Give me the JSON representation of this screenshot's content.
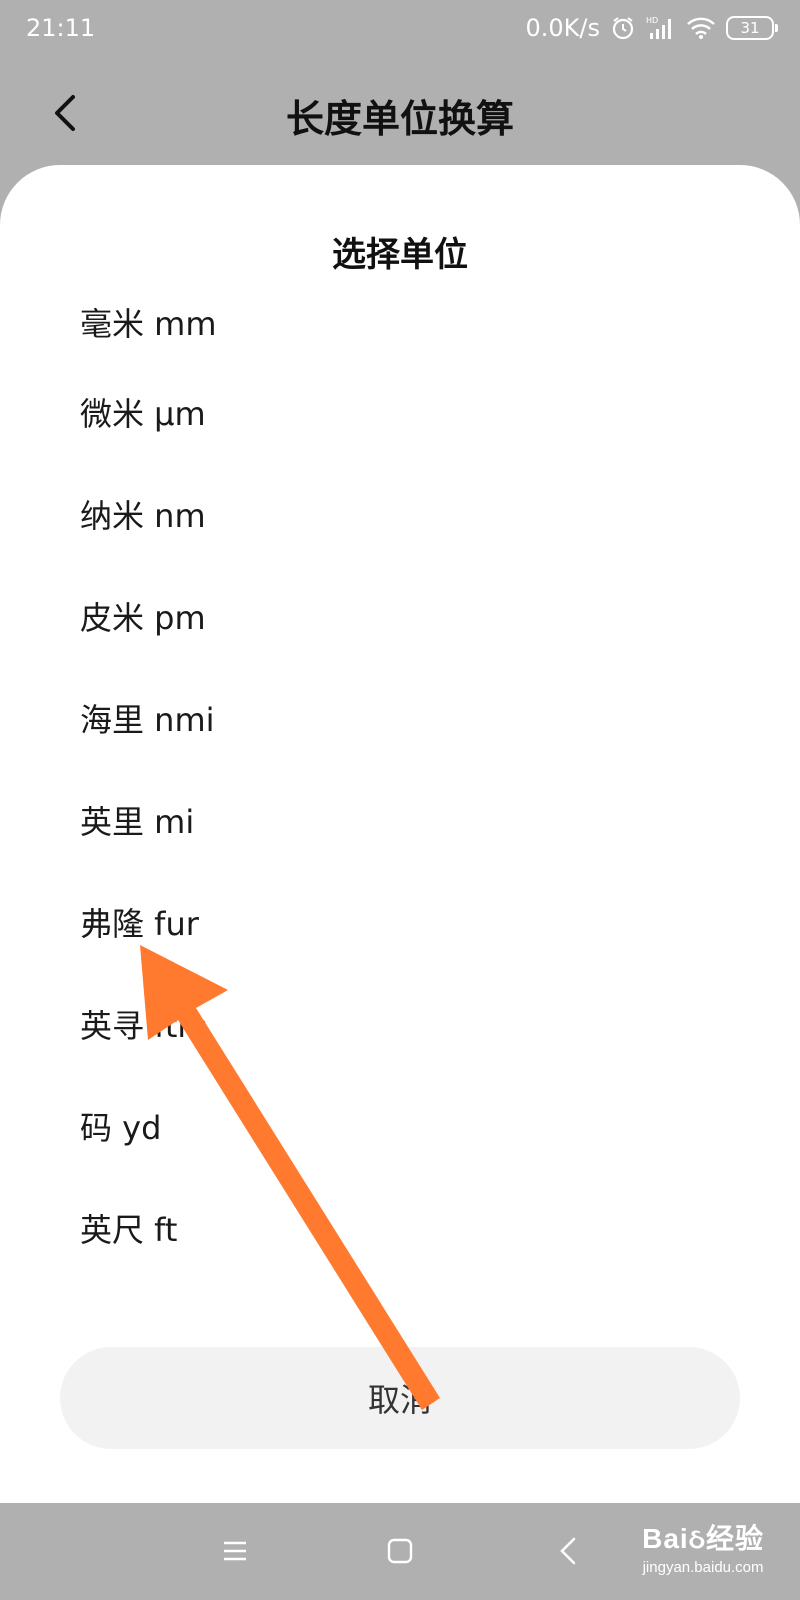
{
  "status_bar": {
    "time": "21:11",
    "network_speed": "0.0K/s",
    "alarm_icon": "alarm-icon",
    "signal_icon": "signal-hd-icon",
    "wifi_icon": "wifi-icon",
    "battery": "31"
  },
  "header": {
    "back_icon": "chevron-left-icon",
    "title": "长度单位换算"
  },
  "sheet": {
    "title": "选择单位",
    "units": [
      {
        "label": "毫米 mm"
      },
      {
        "label": "微米 μm"
      },
      {
        "label": "纳米 nm"
      },
      {
        "label": "皮米 pm"
      },
      {
        "label": "海里 nmi"
      },
      {
        "label": "英里 mi"
      },
      {
        "label": "弗隆 fur"
      },
      {
        "label": "英寻 ftm"
      },
      {
        "label": "码 yd"
      },
      {
        "label": "英尺 ft"
      }
    ],
    "cancel_label": "取消"
  },
  "nav_bar": {
    "menu_icon": "menu-icon",
    "home_icon": "home-square-icon",
    "back_icon": "back-triangle-icon"
  },
  "watermark": {
    "logo": "Baiઠ经验",
    "url": "jingyan.baidu.com"
  },
  "colors": {
    "dim_background": "#b0b0b0",
    "sheet_background": "#ffffff",
    "cancel_background": "#f2f2f2",
    "arrow": "#ff7a2e"
  }
}
